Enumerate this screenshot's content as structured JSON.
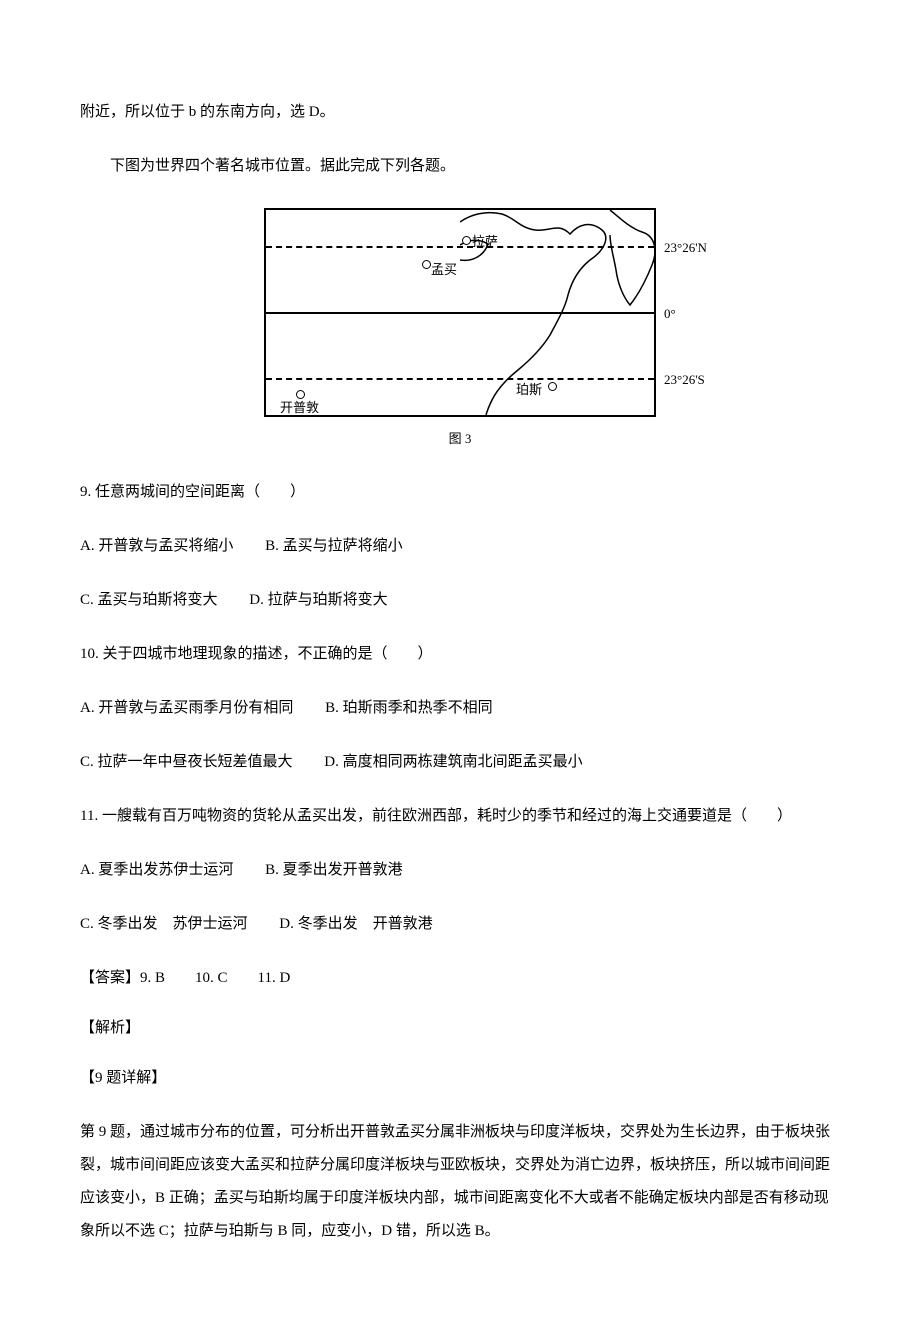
{
  "intro_prev": "附近，所以位于 b 的东南方向，选 D。",
  "intro_fig": "下图为世界四个著名城市位置。据此完成下列各题。",
  "figure": {
    "caption": "图 3",
    "lat_n": "23°26'N",
    "lat_0": "0°",
    "lat_s": "23°26'S",
    "city_lhasa": "拉萨",
    "city_mumbai": "孟买",
    "city_perth": "珀斯",
    "city_capetown": "开普敦"
  },
  "q9": {
    "stem": "9. 任意两城间的空间距离（　　）",
    "A": "A. 开普敦与孟买将缩小",
    "B": "B. 孟买与拉萨将缩小",
    "C": "C. 孟买与珀斯将变大",
    "D": "D. 拉萨与珀斯将变大"
  },
  "q10": {
    "stem": "10. 关于四城市地理现象的描述，不正确的是（　　）",
    "A": "A. 开普敦与孟买雨季月份有相同",
    "B": "B. 珀斯雨季和热季不相同",
    "C": "C. 拉萨一年中昼夜长短差值最大",
    "D": "D. 高度相同两栋建筑南北间距孟买最小"
  },
  "q11": {
    "stem": "11. 一艘载有百万吨物资的货轮从孟买出发，前往欧洲西部，耗时少的季节和经过的海上交通要道是（　　）",
    "A": "A. 夏季出发苏伊士运河",
    "B": "B. 夏季出发开普敦港",
    "C": "C. 冬季出发　苏伊士运河",
    "D": "D. 冬季出发　开普敦港"
  },
  "answers_line": "【答案】9. B　　10. C　　11. D",
  "jiexi": "【解析】",
  "q9_detail_title": "【9 题详解】",
  "q9_detail_body": "第 9 题，通过城市分布的位置，可分析出开普敦孟买分属非洲板块与印度洋板块，交界处为生长边界，由于板块张裂，城市间间距应该变大孟买和拉萨分属印度洋板块与亚欧板块，交界处为消亡边界，板块挤压，所以城市间间距应该变小，B 正确；孟买与珀斯均属于印度洋板块内部，城市间距离变化不大或者不能确定板块内部是否有移动现象所以不选 C；拉萨与珀斯与 B 同，应变小，D 错，所以选 B。"
}
